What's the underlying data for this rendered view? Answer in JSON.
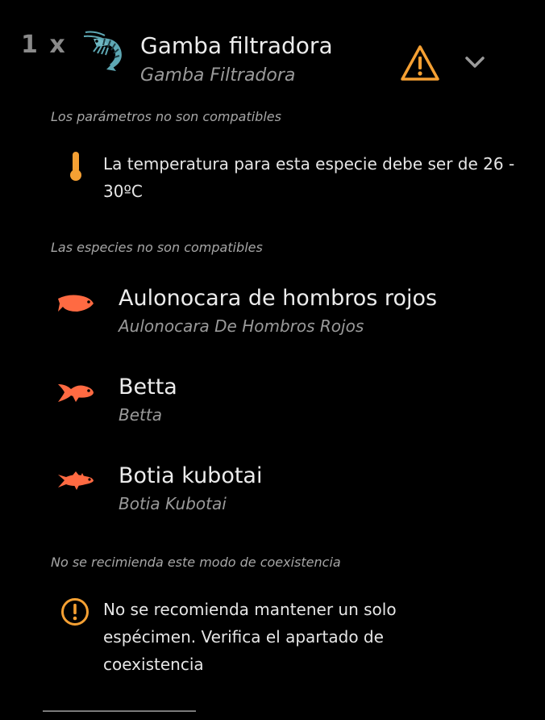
{
  "header": {
    "quantity": "1 x",
    "species_icon": "shrimp-icon",
    "title": "Gamba filtradora",
    "subtitle": "Gamba Filtradora",
    "warning_icon": "warning-triangle-icon",
    "expand_icon": "chevron-down-icon"
  },
  "parameters": {
    "section_label": "Los parámetros no son compatibles",
    "icon": "thermometer-icon",
    "message": "La temperatura para esta especie debe ser de 26 - 30ºC"
  },
  "species_section": {
    "section_label": "Las especies no son compatibles",
    "items": [
      {
        "name": "Aulonocara de hombros rojos",
        "scientific": "Aulonocara De Hombros Rojos",
        "icon": "fish-icon"
      },
      {
        "name": "Betta",
        "scientific": "Betta",
        "icon": "betta-fish-icon"
      },
      {
        "name": "Botia kubotai",
        "scientific": "Botia Kubotai",
        "icon": "loach-fish-icon"
      }
    ]
  },
  "coexistence": {
    "section_label": "No se recimienda este modo de coexistencia",
    "icon": "exclamation-circle-icon",
    "message": "No se recomienda mantener un solo espécimen. Verifica el apartado de coexistencia"
  },
  "colors": {
    "background": "#000000",
    "accent_orange": "#f5a033",
    "fish_coral": "#ff6a42",
    "shrimp_teal": "#5ea8b4",
    "muted_text": "#9a9a9a"
  }
}
